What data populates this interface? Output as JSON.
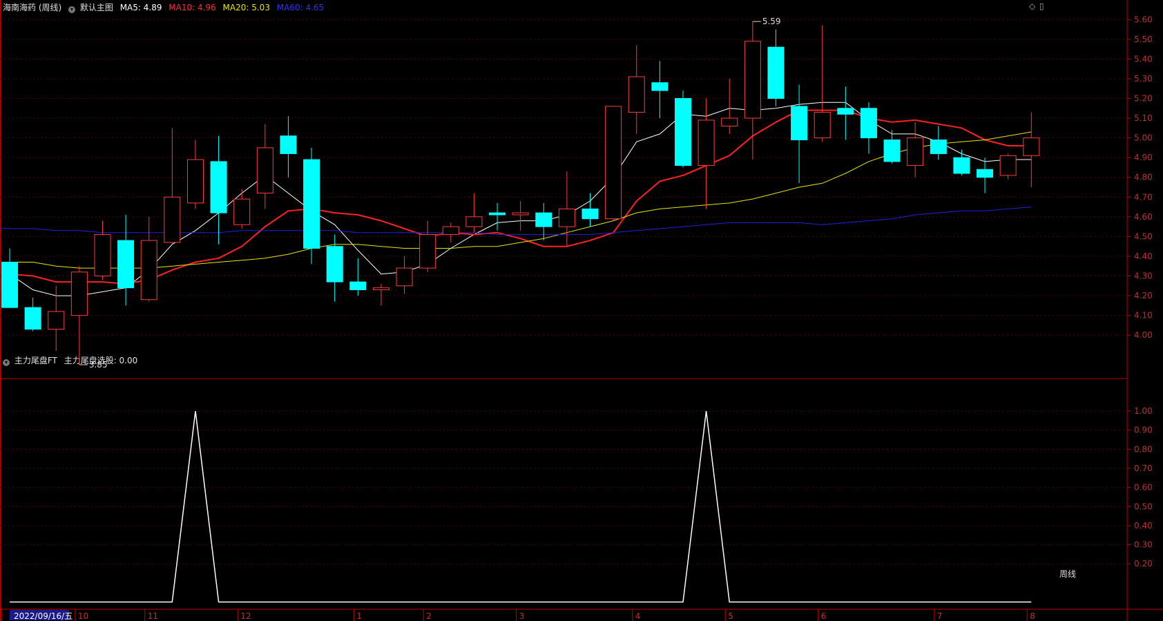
{
  "header": {
    "stock_name": "海南海药 (周线)",
    "main_chart_label": "默认主图",
    "ma5": "MA5: 4.89",
    "ma10": "MA10: 4.96",
    "ma20": "MA20: 5.03",
    "ma60": "MA60: 4.65"
  },
  "sub_header": {
    "indicator_name": "主力尾盘FT",
    "indicator_value": "主力尾盘选股: 0.00"
  },
  "period_label": "周线",
  "colors": {
    "up": "#ff3c3c",
    "down": "#00ffff",
    "ma5": "#ffffff",
    "ma10": "#ff2020",
    "ma20": "#e6e600",
    "ma60": "#2020e0",
    "axis": "#c00000",
    "indicator_line": "#ffffff"
  },
  "chart_data": [
    {
      "type": "candlestick",
      "title": "海南海药 (周线)",
      "price_axis_ticks": [
        "5.60",
        "5.50",
        "5.40",
        "5.30",
        "5.20",
        "5.10",
        "5.00",
        "4.90",
        "4.80",
        "4.70",
        "4.60",
        "4.50",
        "4.40",
        "4.30",
        "4.20",
        "4.10",
        "4.00"
      ],
      "ylim": [
        3.78,
        5.65
      ],
      "x_date_labels": [
        "2022/09/16/五",
        "10",
        "11",
        "12",
        "1",
        "2",
        "3",
        "4",
        "5",
        "6",
        "7",
        "8"
      ],
      "x_label_bars": [
        0,
        3,
        6,
        10,
        15,
        18,
        22,
        27,
        31,
        35,
        40,
        44
      ],
      "annotations": [
        {
          "text": "3.85",
          "bar": 3,
          "price": 3.85
        },
        {
          "text": "5.59",
          "bar": 32,
          "price": 5.59
        }
      ],
      "candles": [
        [
          4.37,
          4.44,
          4.14,
          4.14
        ],
        [
          4.14,
          4.19,
          4.02,
          4.03
        ],
        [
          4.03,
          4.25,
          3.92,
          4.12
        ],
        [
          4.1,
          4.35,
          3.85,
          4.32
        ],
        [
          4.3,
          4.58,
          4.28,
          4.51
        ],
        [
          4.48,
          4.61,
          4.15,
          4.24
        ],
        [
          4.18,
          4.6,
          4.17,
          4.48
        ],
        [
          4.47,
          5.05,
          4.46,
          4.7
        ],
        [
          4.67,
          4.99,
          4.64,
          4.89
        ],
        [
          4.88,
          5.01,
          4.46,
          4.62
        ],
        [
          4.56,
          4.74,
          4.54,
          4.69
        ],
        [
          4.72,
          5.07,
          4.64,
          4.95
        ],
        [
          5.01,
          5.11,
          4.8,
          4.92
        ],
        [
          4.89,
          4.95,
          4.36,
          4.44
        ],
        [
          4.45,
          4.51,
          4.17,
          4.27
        ],
        [
          4.27,
          4.39,
          4.2,
          4.23
        ],
        [
          4.23,
          4.26,
          4.15,
          4.24
        ],
        [
          4.25,
          4.4,
          4.21,
          4.34
        ],
        [
          4.34,
          4.58,
          4.32,
          4.51
        ],
        [
          4.51,
          4.57,
          4.47,
          4.55
        ],
        [
          4.55,
          4.72,
          4.52,
          4.6
        ],
        [
          4.62,
          4.67,
          4.53,
          4.61
        ],
        [
          4.61,
          4.68,
          4.53,
          4.62
        ],
        [
          4.62,
          4.67,
          4.48,
          4.55
        ],
        [
          4.55,
          4.83,
          4.45,
          4.64
        ],
        [
          4.64,
          4.72,
          4.55,
          4.59
        ],
        [
          4.59,
          5.16,
          4.58,
          5.16
        ],
        [
          5.13,
          5.47,
          5.02,
          5.31
        ],
        [
          5.28,
          5.39,
          5.1,
          5.24
        ],
        [
          5.2,
          5.24,
          4.85,
          4.86
        ],
        [
          4.86,
          5.2,
          4.64,
          5.09
        ],
        [
          5.06,
          5.3,
          5.02,
          5.1
        ],
        [
          5.1,
          5.59,
          4.89,
          5.49
        ],
        [
          5.46,
          5.55,
          5.16,
          5.2
        ],
        [
          5.16,
          5.27,
          4.77,
          4.99
        ],
        [
          5.0,
          5.57,
          4.98,
          5.13
        ],
        [
          5.15,
          5.26,
          4.99,
          5.12
        ],
        [
          5.15,
          5.18,
          4.92,
          5.0
        ],
        [
          4.99,
          5.04,
          4.87,
          4.88
        ],
        [
          4.86,
          5.08,
          4.8,
          5.0
        ],
        [
          4.99,
          5.06,
          4.89,
          4.92
        ],
        [
          4.9,
          4.94,
          4.81,
          4.82
        ],
        [
          4.84,
          4.9,
          4.72,
          4.8
        ],
        [
          4.81,
          4.92,
          4.79,
          4.91
        ],
        [
          4.91,
          5.13,
          4.75,
          5.0
        ]
      ],
      "series": [
        {
          "name": "MA5",
          "values": [
            4.31,
            4.23,
            4.2,
            4.2,
            4.22,
            4.24,
            4.33,
            4.46,
            4.53,
            4.62,
            4.72,
            4.81,
            4.72,
            4.63,
            4.56,
            4.43,
            4.31,
            4.32,
            4.36,
            4.44,
            4.51,
            4.57,
            4.58,
            4.58,
            4.61,
            4.68,
            4.8,
            4.98,
            5.02,
            5.12,
            5.11,
            5.15,
            5.14,
            5.15,
            5.17,
            5.18,
            5.18,
            5.09,
            5.02,
            5.02,
            4.98,
            4.92,
            4.88,
            4.89,
            4.89
          ]
        },
        {
          "name": "MA10",
          "values": [
            4.31,
            4.3,
            4.27,
            4.27,
            4.27,
            4.26,
            4.28,
            4.33,
            4.37,
            4.39,
            4.45,
            4.55,
            4.63,
            4.64,
            4.62,
            4.61,
            4.58,
            4.54,
            4.5,
            4.52,
            4.51,
            4.52,
            4.49,
            4.45,
            4.45,
            4.48,
            4.52,
            4.68,
            4.78,
            4.81,
            4.86,
            4.91,
            5.01,
            5.08,
            5.14,
            5.14,
            5.14,
            5.1,
            5.08,
            5.09,
            5.07,
            5.05,
            4.99,
            4.96,
            4.96
          ]
        },
        {
          "name": "MA20",
          "values": [
            4.37,
            4.37,
            4.35,
            4.34,
            4.34,
            4.34,
            4.34,
            4.35,
            4.36,
            4.37,
            4.38,
            4.39,
            4.41,
            4.44,
            4.46,
            4.46,
            4.45,
            4.44,
            4.44,
            4.44,
            4.45,
            4.45,
            4.47,
            4.49,
            4.52,
            4.55,
            4.58,
            4.62,
            4.64,
            4.65,
            4.66,
            4.67,
            4.69,
            4.72,
            4.75,
            4.77,
            4.82,
            4.88,
            4.92,
            4.95,
            4.97,
            4.98,
            4.99,
            5.01,
            5.03
          ]
        },
        {
          "name": "MA60",
          "values": [
            4.56,
            4.56,
            4.55,
            4.55,
            4.54,
            4.54,
            4.53,
            4.53,
            4.52,
            4.52,
            4.52,
            4.52,
            4.52,
            4.52,
            4.53,
            4.53,
            4.53,
            4.53,
            4.53,
            4.52,
            4.52,
            4.52,
            4.52,
            4.52,
            4.52,
            4.51,
            4.51,
            4.51,
            4.51,
            4.51,
            4.52,
            4.53,
            4.54,
            4.55,
            4.56,
            4.57,
            4.57,
            4.57,
            4.57,
            4.56,
            4.57,
            4.58,
            4.59,
            4.61,
            4.62,
            4.63,
            4.63,
            4.64,
            4.65
          ]
        }
      ]
    },
    {
      "type": "line",
      "title": "主力尾盘FT",
      "y_axis_ticks": [
        "1.00",
        "0.90",
        "0.80",
        "0.70",
        "0.60",
        "0.50",
        "0.40",
        "0.30",
        "0.20"
      ],
      "ylim": [
        -0.02,
        1.08
      ],
      "series": [
        {
          "name": "主力尾盘选股",
          "values": [
            0,
            0,
            0,
            0,
            0,
            0,
            0,
            0,
            1,
            0,
            0,
            0,
            0,
            0,
            0,
            0,
            0,
            0,
            0,
            0,
            0,
            0,
            0,
            0,
            0,
            0,
            0,
            0,
            0,
            0,
            1,
            0,
            0,
            0,
            0,
            0,
            0,
            0,
            0,
            0,
            0,
            0,
            0,
            0,
            0
          ]
        }
      ]
    }
  ]
}
